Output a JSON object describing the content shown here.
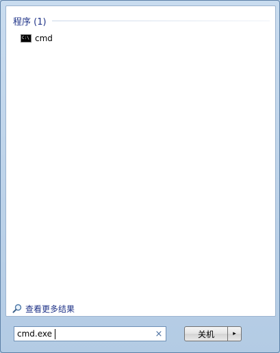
{
  "results": {
    "group_title": "程序 (1)",
    "items": [
      {
        "label": "cmd",
        "icon": "cmd-console-icon",
        "icon_text": "C:\\"
      }
    ],
    "see_more_label": "查看更多结果",
    "see_more_icon": "magnifier-icon"
  },
  "search": {
    "value": "cmd.exe",
    "clear_symbol": "×"
  },
  "shutdown": {
    "label": "关机",
    "arrow_symbol": "▸"
  },
  "colors": {
    "link_blue": "#1e3287",
    "frame_blue": "#b9cfe6"
  }
}
